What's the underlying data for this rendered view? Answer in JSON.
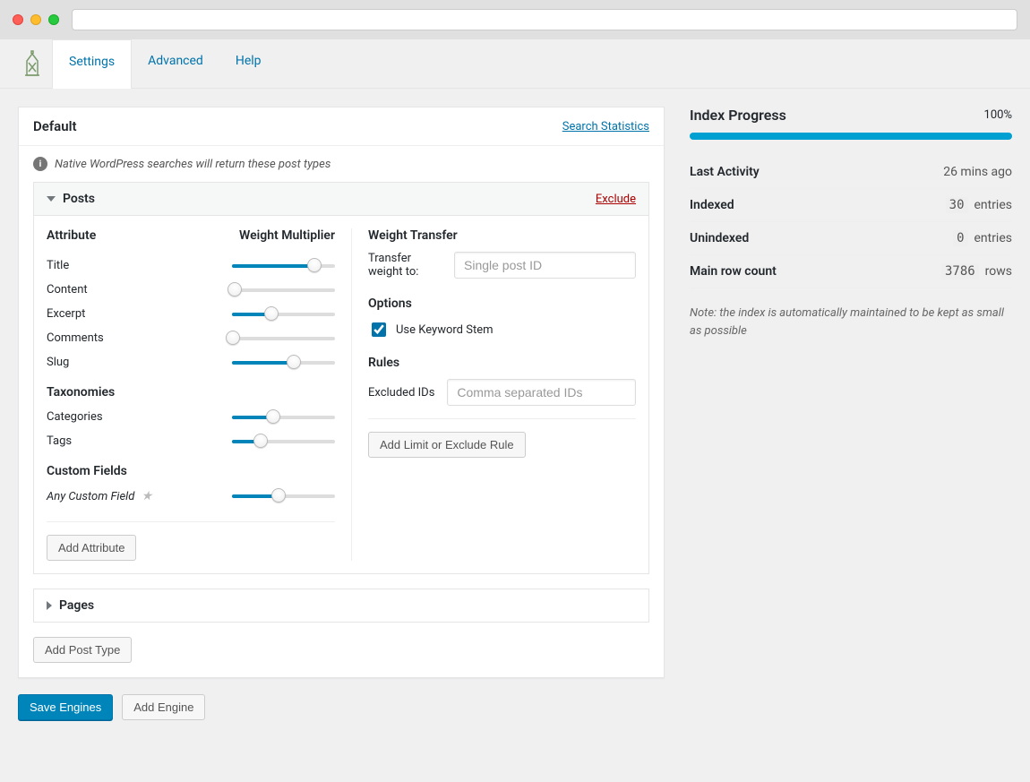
{
  "tabs": {
    "settings": "Settings",
    "advanced": "Advanced",
    "help": "Help"
  },
  "panel": {
    "title": "Default",
    "stats_link": "Search Statistics",
    "info_text": "Native WordPress searches will return these post types"
  },
  "posts_section": {
    "title": "Posts",
    "exclude": "Exclude",
    "col_attribute": "Attribute",
    "col_multiplier": "Weight Multiplier",
    "attributes": [
      {
        "label": "Title",
        "value": 80
      },
      {
        "label": "Content",
        "value": 3
      },
      {
        "label": "Excerpt",
        "value": 38
      },
      {
        "label": "Comments",
        "value": 1
      },
      {
        "label": "Slug",
        "value": 60
      }
    ],
    "taxonomies_label": "Taxonomies",
    "taxonomies": [
      {
        "label": "Categories",
        "value": 40
      },
      {
        "label": "Tags",
        "value": 28
      }
    ],
    "custom_fields_label": "Custom Fields",
    "custom_field": {
      "label": "Any Custom Field",
      "value": 45
    },
    "add_attribute": "Add Attribute"
  },
  "weight_transfer": {
    "title": "Weight Transfer",
    "label": "Transfer weight to:",
    "placeholder": "Single post ID"
  },
  "options": {
    "title": "Options",
    "keyword_stem": "Use Keyword Stem",
    "keyword_stem_checked": true
  },
  "rules": {
    "title": "Rules",
    "excluded_ids_label": "Excluded IDs",
    "excluded_ids_placeholder": "Comma separated IDs",
    "add_rule": "Add Limit or Exclude Rule"
  },
  "pages_section": {
    "title": "Pages"
  },
  "add_post_type": "Add Post Type",
  "footer_buttons": {
    "save": "Save Engines",
    "add_engine": "Add Engine"
  },
  "sidebar": {
    "title": "Index Progress",
    "percent": "100%",
    "percent_value": 100,
    "stats": [
      {
        "label": "Last Activity",
        "value": "26 mins ago",
        "code": false
      },
      {
        "label": "Indexed",
        "value": "30",
        "suffix": "entries",
        "code": true
      },
      {
        "label": "Unindexed",
        "value": "0",
        "suffix": "entries",
        "code": true
      },
      {
        "label": "Main row count",
        "value": "3786",
        "suffix": "rows",
        "code": true
      }
    ],
    "note": "Note: the index is automatically maintained to be kept as small as possible"
  }
}
